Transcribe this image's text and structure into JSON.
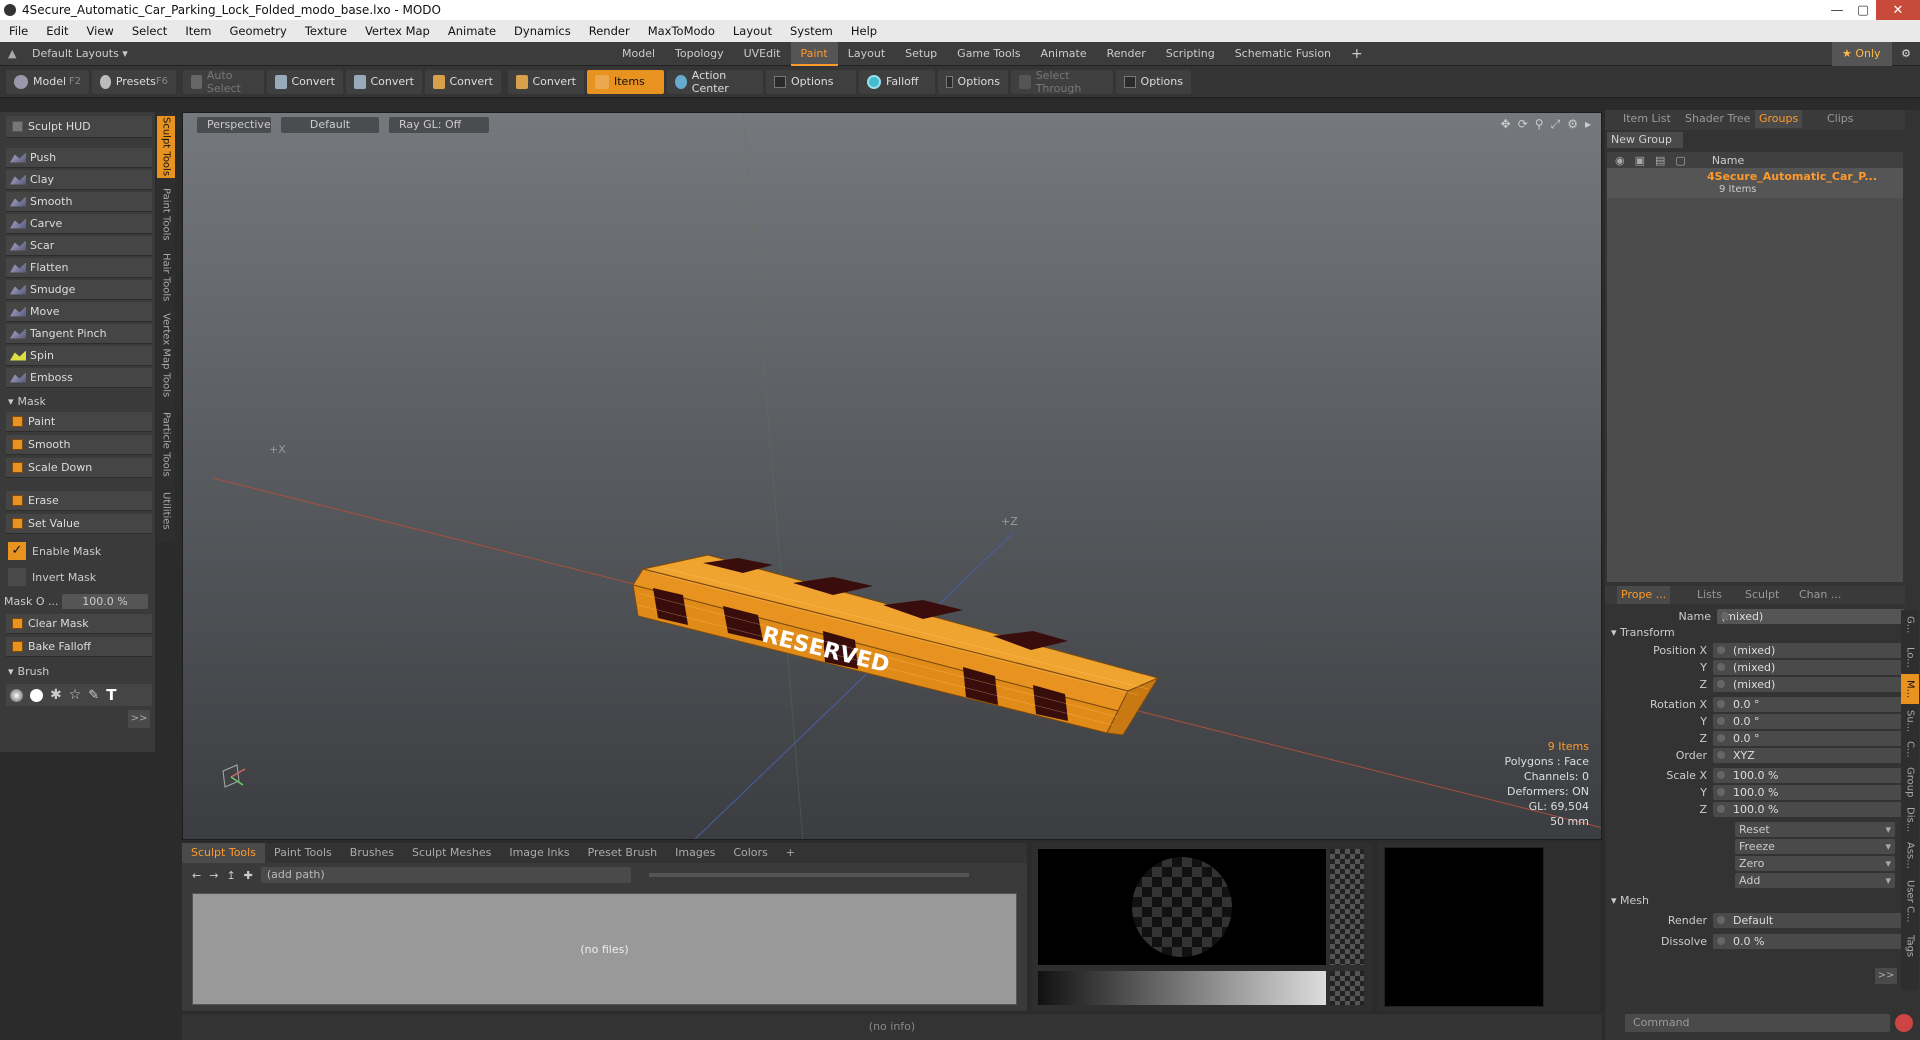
{
  "window": {
    "title": "4Secure_Automatic_Car_Parking_Lock_Folded_modo_base.lxo - MODO"
  },
  "menu": [
    "File",
    "Edit",
    "View",
    "Select",
    "Item",
    "Geometry",
    "Texture",
    "Vertex Map",
    "Animate",
    "Dynamics",
    "Render",
    "MaxToModo",
    "Layout",
    "System",
    "Help"
  ],
  "layoutbar": {
    "layouts_label": "Default Layouts ▾",
    "tabs": [
      "Model",
      "Topology",
      "UVEdit",
      "Paint",
      "Layout",
      "Setup",
      "Game Tools",
      "Animate",
      "Render",
      "Scripting",
      "Schematic Fusion"
    ],
    "add": "+",
    "only_label": "★ Only"
  },
  "toolbar": {
    "model": "Model",
    "model_key": "F2",
    "presets": "Presets",
    "presets_key": "F6",
    "auto_select": "Auto Select",
    "convert": "Convert",
    "items": "Items",
    "action_center": "Action Center",
    "options": "Options",
    "falloff": "Falloff",
    "select_through": "Select Through"
  },
  "left": {
    "hud": "Sculpt HUD",
    "tools": [
      "Push",
      "Clay",
      "Smooth",
      "Carve",
      "Scar",
      "Flatten",
      "Smudge",
      "Move",
      "Tangent Pinch",
      "Spin",
      "Emboss"
    ],
    "mask_header": "Mask",
    "mask_tools": [
      "Paint",
      "Smooth",
      "Scale Down"
    ],
    "erase": "Erase",
    "set_value": "Set Value",
    "enable_mask": "Enable Mask",
    "invert_mask": "Invert Mask",
    "mask_opacity_label": "Mask O ...",
    "mask_opacity_value": "100.0 %",
    "clear_mask": "Clear Mask",
    "bake_falloff": "Bake Falloff",
    "brush_header": "Brush",
    "more": ">>"
  },
  "vtabs": [
    "Sculpt Tools",
    "Paint Tools",
    "Hair Tools",
    "Vertex Map Tools",
    "Particle Tools",
    "Utilities"
  ],
  "viewport": {
    "view": "Perspective",
    "shading": "Default",
    "raygl": "Ray GL: Off",
    "model_text": "RESERVED",
    "axis_x": "+X",
    "axis_z": "+Z",
    "info": {
      "items": "9 Items",
      "polygons": "Polygons : Face",
      "channels": "Channels: 0",
      "deformers": "Deformers: ON",
      "gl": "GL: 69,504",
      "scale": "50 mm"
    }
  },
  "bottom": {
    "tabs": [
      "Sculpt Tools",
      "Paint Tools",
      "Brushes",
      "Sculpt Meshes",
      "Image Inks",
      "Preset Brush",
      "Images",
      "Colors",
      "+"
    ],
    "path_placeholder": "(add path)",
    "no_files": "(no files)"
  },
  "status": "(no info)",
  "right": {
    "top_tabs": [
      "Item List",
      "Shader Tree",
      "Groups",
      "Clips"
    ],
    "new_group": "New Group",
    "name_col": "Name",
    "group_name": "4Secure_Automatic_Car_P...",
    "group_count": "9 Items",
    "prop_tabs": [
      "Prope ...",
      "Lists",
      "Sculpt",
      "Chan ..."
    ],
    "name_label": "Name",
    "name_value": "(mixed)",
    "transform_header": "Transform",
    "rows": [
      {
        "label": "Position X",
        "value": "(mixed)"
      },
      {
        "label": "Y",
        "value": "(mixed)"
      },
      {
        "label": "Z",
        "value": "(mixed)"
      },
      {
        "label": "Rotation X",
        "value": "0.0 °"
      },
      {
        "label": "Y",
        "value": "0.0 °"
      },
      {
        "label": "Z",
        "value": "0.0 °"
      }
    ],
    "order_label": "Order",
    "order_value": "XYZ",
    "scale_rows": [
      {
        "label": "Scale X",
        "value": "100.0 %"
      },
      {
        "label": "Y",
        "value": "100.0 %"
      },
      {
        "label": "Z",
        "value": "100.0 %"
      }
    ],
    "actions": [
      "Reset",
      "Freeze",
      "Zero",
      "Add"
    ],
    "mesh_header": "Mesh",
    "render_label": "Render",
    "render_value": "Default",
    "dissolve_label": "Dissolve",
    "dissolve_value": "0.0 %",
    "more": ">>",
    "command_placeholder": "Command",
    "side_tabs": [
      "G...",
      "Lo...",
      "M...",
      "Su...",
      "C...",
      "Group",
      "Dis...",
      "Ass...",
      "User C...",
      "Tags"
    ]
  }
}
